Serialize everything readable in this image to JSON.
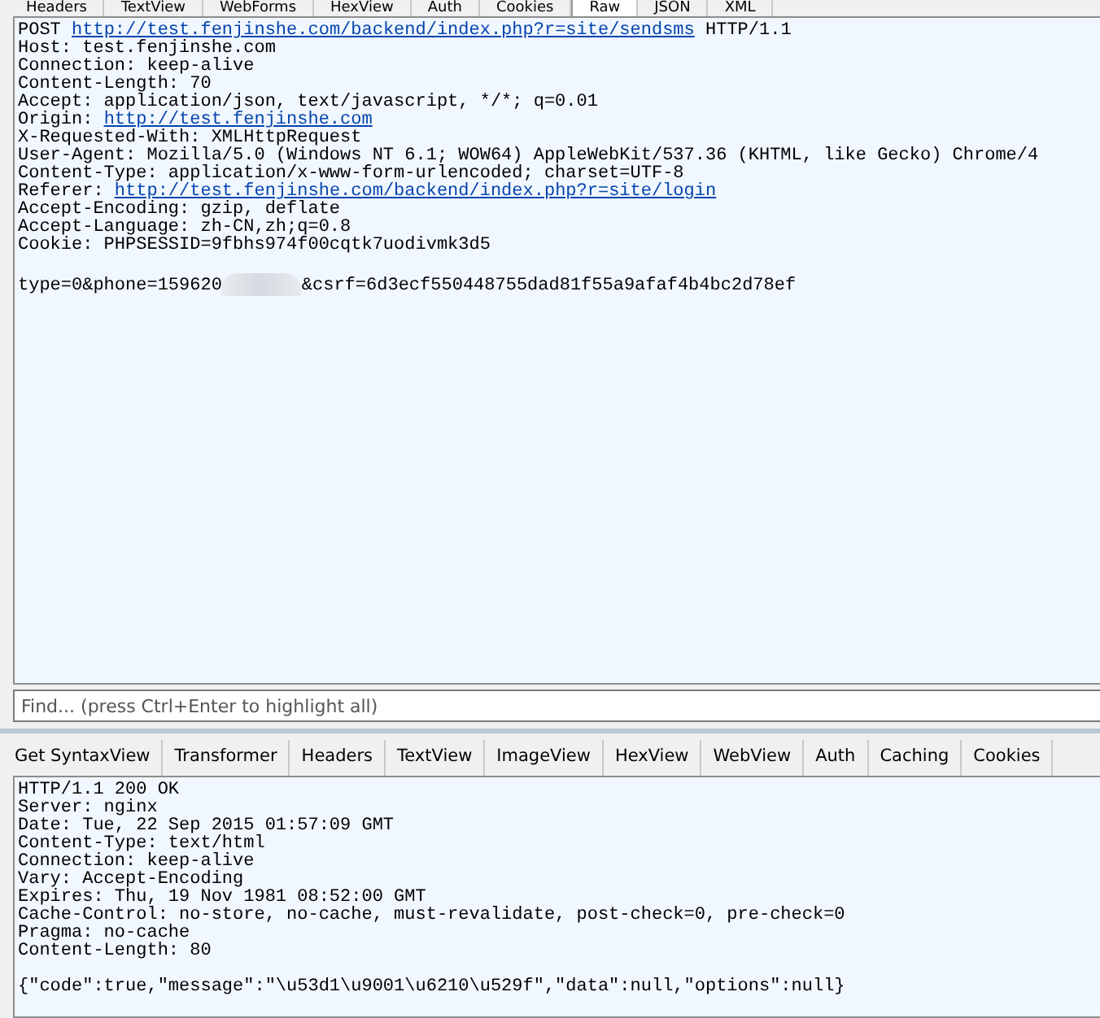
{
  "request_tabs": [
    {
      "label": "Headers",
      "selected": false
    },
    {
      "label": "TextView",
      "selected": false
    },
    {
      "label": "WebForms",
      "selected": false
    },
    {
      "label": "HexView",
      "selected": false
    },
    {
      "label": "Auth",
      "selected": false
    },
    {
      "label": "Cookies",
      "selected": false
    },
    {
      "label": "Raw",
      "selected": true
    },
    {
      "label": "JSON",
      "selected": false
    },
    {
      "label": "XML",
      "selected": false
    }
  ],
  "request": {
    "lines": [
      {
        "kind": "request",
        "parts": [
          "POST ",
          "http://test.fenjinshe.com/backend/index.php?r=site/sendsms",
          " HTTP/1.1"
        ]
      },
      {
        "kind": "plain",
        "text": "Host: test.fenjinshe.com"
      },
      {
        "kind": "plain",
        "text": "Connection: keep-alive"
      },
      {
        "kind": "plain",
        "text": "Content-Length: 70"
      },
      {
        "kind": "plain",
        "text": "Accept: application/json, text/javascript, */*; q=0.01"
      },
      {
        "kind": "link",
        "parts": [
          "Origin: ",
          "http://test.fenjinshe.com"
        ]
      },
      {
        "kind": "plain",
        "text": "X-Requested-With: XMLHttpRequest"
      },
      {
        "kind": "plain",
        "text": "User-Agent: Mozilla/5.0 (Windows NT 6.1; WOW64) AppleWebKit/537.36 (KHTML, like Gecko) Chrome/4"
      },
      {
        "kind": "plain",
        "text": "Content-Type: application/x-www-form-urlencoded; charset=UTF-8"
      },
      {
        "kind": "link",
        "parts": [
          "Referer: ",
          "http://test.fenjinshe.com/backend/index.php?r=site/login"
        ]
      },
      {
        "kind": "plain",
        "text": "Accept-Encoding: gzip, deflate"
      },
      {
        "kind": "plain",
        "text": "Accept-Language: zh-CN,zh;q=0.8"
      },
      {
        "kind": "plain",
        "text": "Cookie: PHPSESSID=9fbhs974f00cqtk7uodivmk3d5"
      },
      {
        "kind": "blank"
      },
      {
        "kind": "redacted",
        "parts": [
          "type=0&phone=159620",
          "&csrf=6d3ecf550448755dad81f55a9afaf4b4bc2d78ef"
        ]
      }
    ]
  },
  "find": {
    "placeholder": "Find... (press Ctrl+Enter to highlight all)"
  },
  "response_tabs": [
    {
      "label": "Get SyntaxView",
      "selected": false
    },
    {
      "label": "Transformer",
      "selected": false
    },
    {
      "label": "Headers",
      "selected": false
    },
    {
      "label": "TextView",
      "selected": false
    },
    {
      "label": "ImageView",
      "selected": false
    },
    {
      "label": "HexView",
      "selected": false
    },
    {
      "label": "WebView",
      "selected": false
    },
    {
      "label": "Auth",
      "selected": false
    },
    {
      "label": "Caching",
      "selected": false
    },
    {
      "label": "Cookies",
      "selected": false
    }
  ],
  "response": {
    "lines": [
      {
        "kind": "plain",
        "text": "HTTP/1.1 200 OK"
      },
      {
        "kind": "plain",
        "text": "Server: nginx"
      },
      {
        "kind": "plain",
        "text": "Date: Tue, 22 Sep 2015 01:57:09 GMT"
      },
      {
        "kind": "plain",
        "text": "Content-Type: text/html"
      },
      {
        "kind": "plain",
        "text": "Connection: keep-alive"
      },
      {
        "kind": "plain",
        "text": "Vary: Accept-Encoding"
      },
      {
        "kind": "plain",
        "text": "Expires: Thu, 19 Nov 1981 08:52:00 GMT"
      },
      {
        "kind": "plain",
        "text": "Cache-Control: no-store, no-cache, must-revalidate, post-check=0, pre-check=0"
      },
      {
        "kind": "plain",
        "text": "Pragma: no-cache"
      },
      {
        "kind": "plain",
        "text": "Content-Length: 80"
      },
      {
        "kind": "blank"
      },
      {
        "kind": "plain",
        "text": "{\"code\":true,\"message\":\"\\u53d1\\u9001\\u6210\\u529f\",\"data\":null,\"options\":null}"
      }
    ]
  }
}
